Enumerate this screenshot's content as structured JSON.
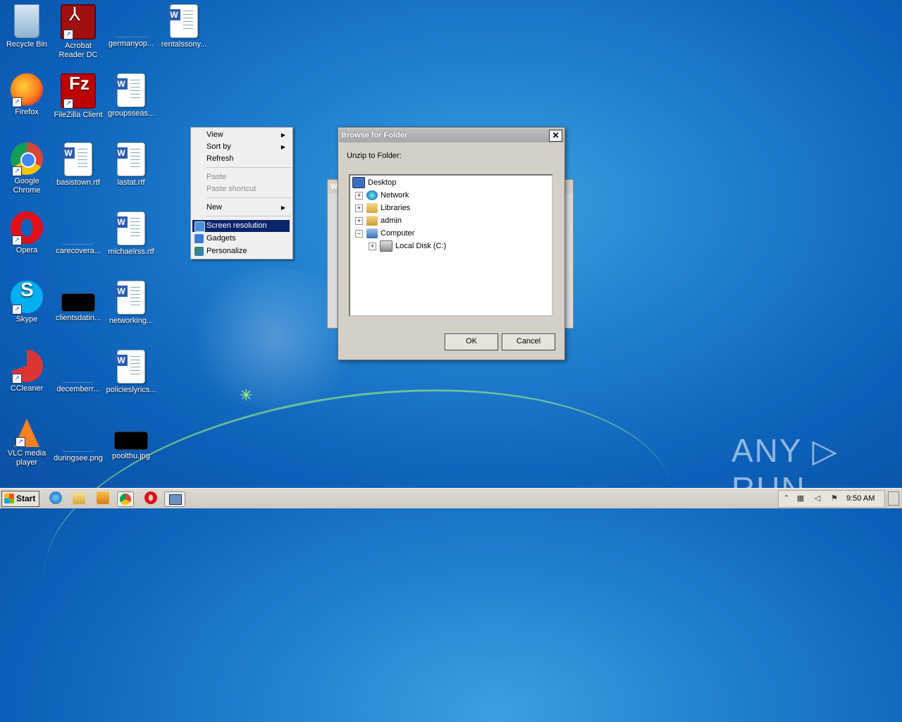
{
  "desktop": {
    "icons": [
      {
        "label": "Recycle Bin"
      },
      {
        "label": "Acrobat Reader DC"
      },
      {
        "label": "germanyop..."
      },
      {
        "label": "rentalssony..."
      },
      {
        "label": "Firefox"
      },
      {
        "label": "FileZilla Client"
      },
      {
        "label": "groupsseas..."
      },
      {
        "label": "Google Chrome"
      },
      {
        "label": "basistown.rtf"
      },
      {
        "label": "lastat.rtf"
      },
      {
        "label": "Opera"
      },
      {
        "label": "carecovera..."
      },
      {
        "label": "michaelrss.rtf"
      },
      {
        "label": "Skype"
      },
      {
        "label": "clientsdatin..."
      },
      {
        "label": "networking..."
      },
      {
        "label": "CCleaner"
      },
      {
        "label": "decemberr..."
      },
      {
        "label": "policieslyrics..."
      },
      {
        "label": "VLC media player"
      },
      {
        "label": "duringsee.png"
      },
      {
        "label": "poolthu.jpg"
      }
    ]
  },
  "context_menu": {
    "items": [
      {
        "label": "View",
        "submenu": true
      },
      {
        "label": "Sort by",
        "submenu": true
      },
      {
        "label": "Refresh"
      },
      {
        "label": "Paste",
        "disabled": true
      },
      {
        "label": "Paste shortcut",
        "disabled": true
      },
      {
        "label": "New",
        "submenu": true
      },
      {
        "label": "Screen resolution",
        "highlighted": true
      },
      {
        "label": "Gadgets"
      },
      {
        "label": "Personalize"
      }
    ]
  },
  "background_dialog": {
    "title": "W"
  },
  "dialog": {
    "title": "Browse for Folder",
    "close_glyph": "✕",
    "prompt": "Unzip to Folder:",
    "tree": [
      {
        "label": "Desktop",
        "expander": ""
      },
      {
        "label": "Network",
        "expander": "+"
      },
      {
        "label": "Libraries",
        "expander": "+"
      },
      {
        "label": "admin",
        "expander": "+"
      },
      {
        "label": "Computer",
        "expander": "−"
      },
      {
        "label": "Local Disk (C:)",
        "expander": "+"
      }
    ],
    "ok_label": "OK",
    "cancel_label": "Cancel"
  },
  "taskbar": {
    "start_label": "Start",
    "clock": "9:50 AM"
  },
  "watermark": "ANY ▷ RUN",
  "colors": {
    "menu_highlight": "#0a246a",
    "desktop_blue": "#1f7fcf"
  }
}
